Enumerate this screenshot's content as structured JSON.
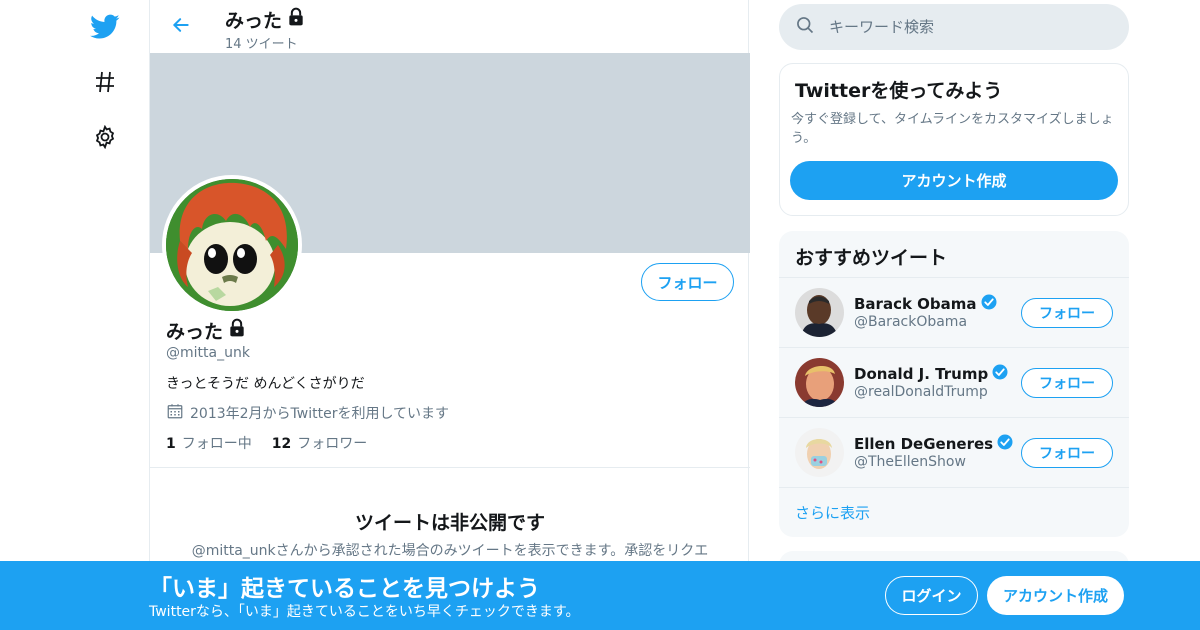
{
  "nav": {
    "icons": [
      "twitter-logo-icon",
      "hashtag-icon",
      "settings-gear-icon"
    ]
  },
  "header": {
    "name": "みった",
    "tweet_count": "14 ツイート",
    "back_icon": "back-arrow-icon",
    "lock_icon": "lock-icon"
  },
  "profile": {
    "name": "みった",
    "handle": "@mitta_unk",
    "bio": "きっとそうだ めんどくさがりだ",
    "joined": "2013年2月からTwitterを利用しています",
    "following_count": "1",
    "following_label": "フォロー中",
    "followers_count": "12",
    "followers_label": "フォロワー",
    "follow_label": "フォロー",
    "banner_color": "#ccd6dd"
  },
  "private_notice": {
    "title": "ツイートは非公開です",
    "desc": "@mitta_unkさんから承認された場合のみツイートを表示できます。承認をリクエ"
  },
  "search": {
    "placeholder": "キーワード検索"
  },
  "signup": {
    "title": "Twitterを使ってみよう",
    "desc": "今すぐ登録して、タイムラインをカスタマイズしましょう。",
    "button": "アカウント作成"
  },
  "recommended": {
    "title": "おすすめツイート",
    "items": [
      {
        "name": "Barack Obama",
        "handle": "@BarackObama",
        "follow": "フォロー",
        "verified": true
      },
      {
        "name": "Donald J. Trump",
        "handle": "@realDonaldTrump",
        "follow": "フォロー",
        "verified": true
      },
      {
        "name": "Ellen DeGeneres",
        "handle": "@TheEllenShow",
        "follow": "フォロー",
        "verified": true
      }
    ],
    "more": "さらに表示"
  },
  "bottom_bar": {
    "title": "「いま」起きていることを見つけよう",
    "subtitle": "Twitterなら、「いま」起きていることをいち早くチェックできます。",
    "login": "ログイン",
    "create": "アカウント作成"
  },
  "colors": {
    "accent": "#1da1f2",
    "text_secondary": "#657786",
    "border": "#e6ecf0"
  }
}
